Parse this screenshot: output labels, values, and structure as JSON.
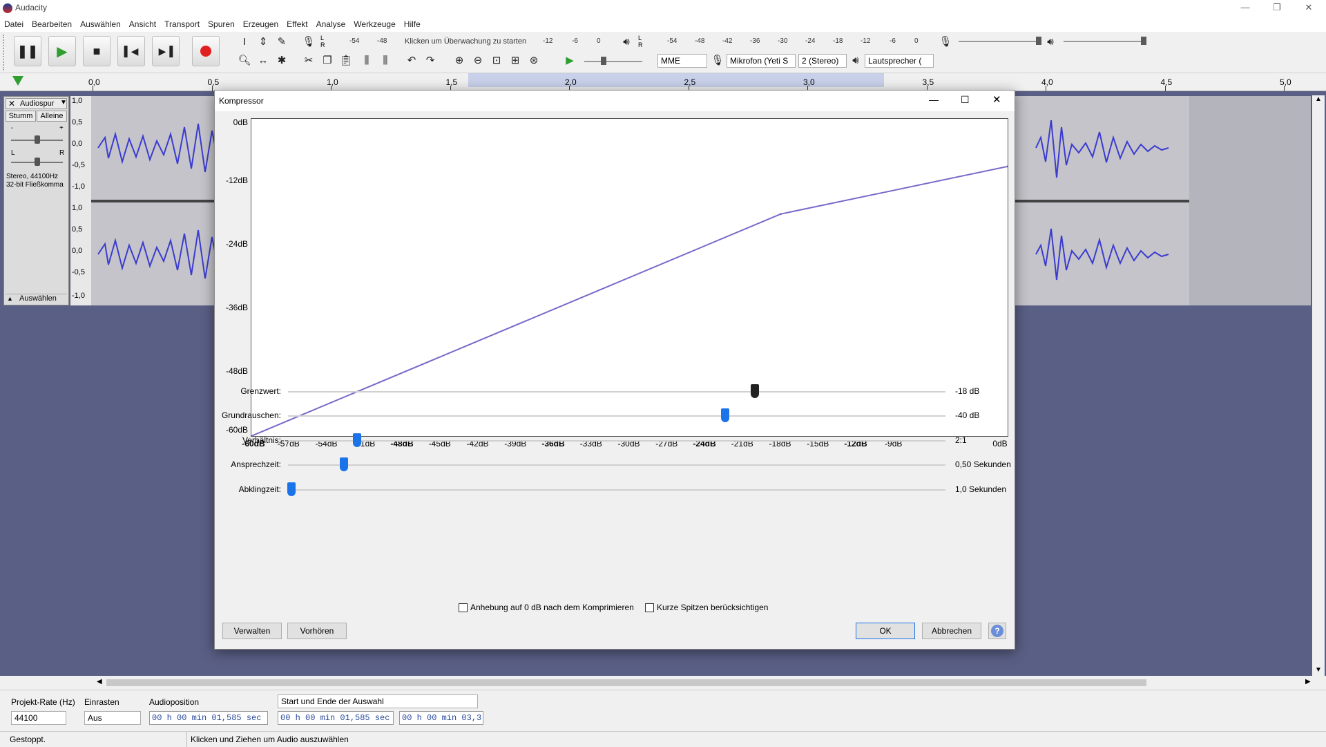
{
  "app": {
    "title": "Audacity",
    "brand_color": "#1a73e8"
  },
  "menu": {
    "items": [
      "Datei",
      "Bearbeiten",
      "Auswählen",
      "Ansicht",
      "Transport",
      "Spuren",
      "Erzeugen",
      "Effekt",
      "Analyse",
      "Werkzeuge",
      "Hilfe"
    ]
  },
  "toolbar": {
    "record_meter_scale": [
      "-54",
      "-48",
      "Klicken um Überwachung zu starten",
      "-12",
      "-6",
      "0"
    ],
    "play_meter_scale": [
      "-54",
      "-48",
      "-42",
      "-36",
      "-30",
      "-24",
      "-18",
      "-12",
      "-6",
      "0"
    ],
    "host": "MME",
    "mic": "Mikrofon (Yeti S",
    "channels": "2 (Stereo)",
    "speaker": "Lautsprecher ("
  },
  "ruler": {
    "ticks": [
      "0,0",
      "0,5",
      "1,0",
      "1,5",
      "2,0",
      "2,5",
      "3,0",
      "3,5",
      "4,0",
      "4,5",
      "5,0"
    ]
  },
  "track": {
    "name": "Audiospur",
    "mute": "Stumm",
    "solo": "Alleine",
    "gain_l": "-",
    "gain_r": "+",
    "pan_l": "L",
    "pan_r": "R",
    "info1": "Stereo, 44100Hz",
    "info2": "32-bit Fließkomma",
    "select": "Auswählen",
    "scale": [
      "1,0",
      "0,5",
      "0,0",
      "-0,5",
      "-1,0"
    ]
  },
  "dialog": {
    "title": "Kompressor",
    "y_labels": [
      "0dB",
      "-12dB",
      "-24dB",
      "-36dB",
      "-48dB",
      "-60dB"
    ],
    "x_labels": [
      "-60dB",
      "-57dB",
      "-54dB",
      "-51dB",
      "-48dB",
      "-45dB",
      "-42dB",
      "-39dB",
      "-36dB",
      "-33dB",
      "-30dB",
      "-27dB",
      "-24dB",
      "-21dB",
      "-18dB",
      "-15dB",
      "-12dB",
      "-9dB",
      "0dB"
    ],
    "sliders": [
      {
        "label": "Grenzwert:",
        "value": "-18 dB",
        "fraction": 0.71
      },
      {
        "label": "Grundrauschen:",
        "value": "-40 dB",
        "fraction": 0.665
      },
      {
        "label": "Verhältnis:",
        "value": "2:1",
        "fraction": 0.105
      },
      {
        "label": "Ansprechzeit:",
        "value": "0,50 Sekunden",
        "fraction": 0.085
      },
      {
        "label": "Abklingzeit:",
        "value": "1,0 Sekunden",
        "fraction": 0.005
      }
    ],
    "check1": "Anhebung auf 0 dB nach dem Komprimieren",
    "check2": "Kurze Spitzen berücksichtigen",
    "manage": "Verwalten",
    "preview": "Vorhören",
    "ok": "OK",
    "cancel": "Abbrechen",
    "help": "?"
  },
  "selbar": {
    "rate_label": "Projekt-Rate (Hz)",
    "rate": "44100",
    "snap_label": "Einrasten",
    "snap": "Aus",
    "pos_label": "Audioposition",
    "pos": "00 h 00 min 01,585 sec",
    "mode": "Start und Ende der Auswahl",
    "start": "00 h 00 min 01,585 sec",
    "end": "00 h 00 min 03,3"
  },
  "status": {
    "left": "Gestoppt.",
    "right": "Klicken und Ziehen um Audio auszuwählen"
  },
  "chart_data": {
    "type": "line",
    "x": [
      -60,
      -18,
      0
    ],
    "values": [
      -60,
      -18,
      -9
    ],
    "xlim": [
      -60,
      0
    ],
    "ylim": [
      -60,
      0
    ],
    "title": "",
    "xlabel": "",
    "ylabel": "",
    "color": "#7b68c9"
  }
}
